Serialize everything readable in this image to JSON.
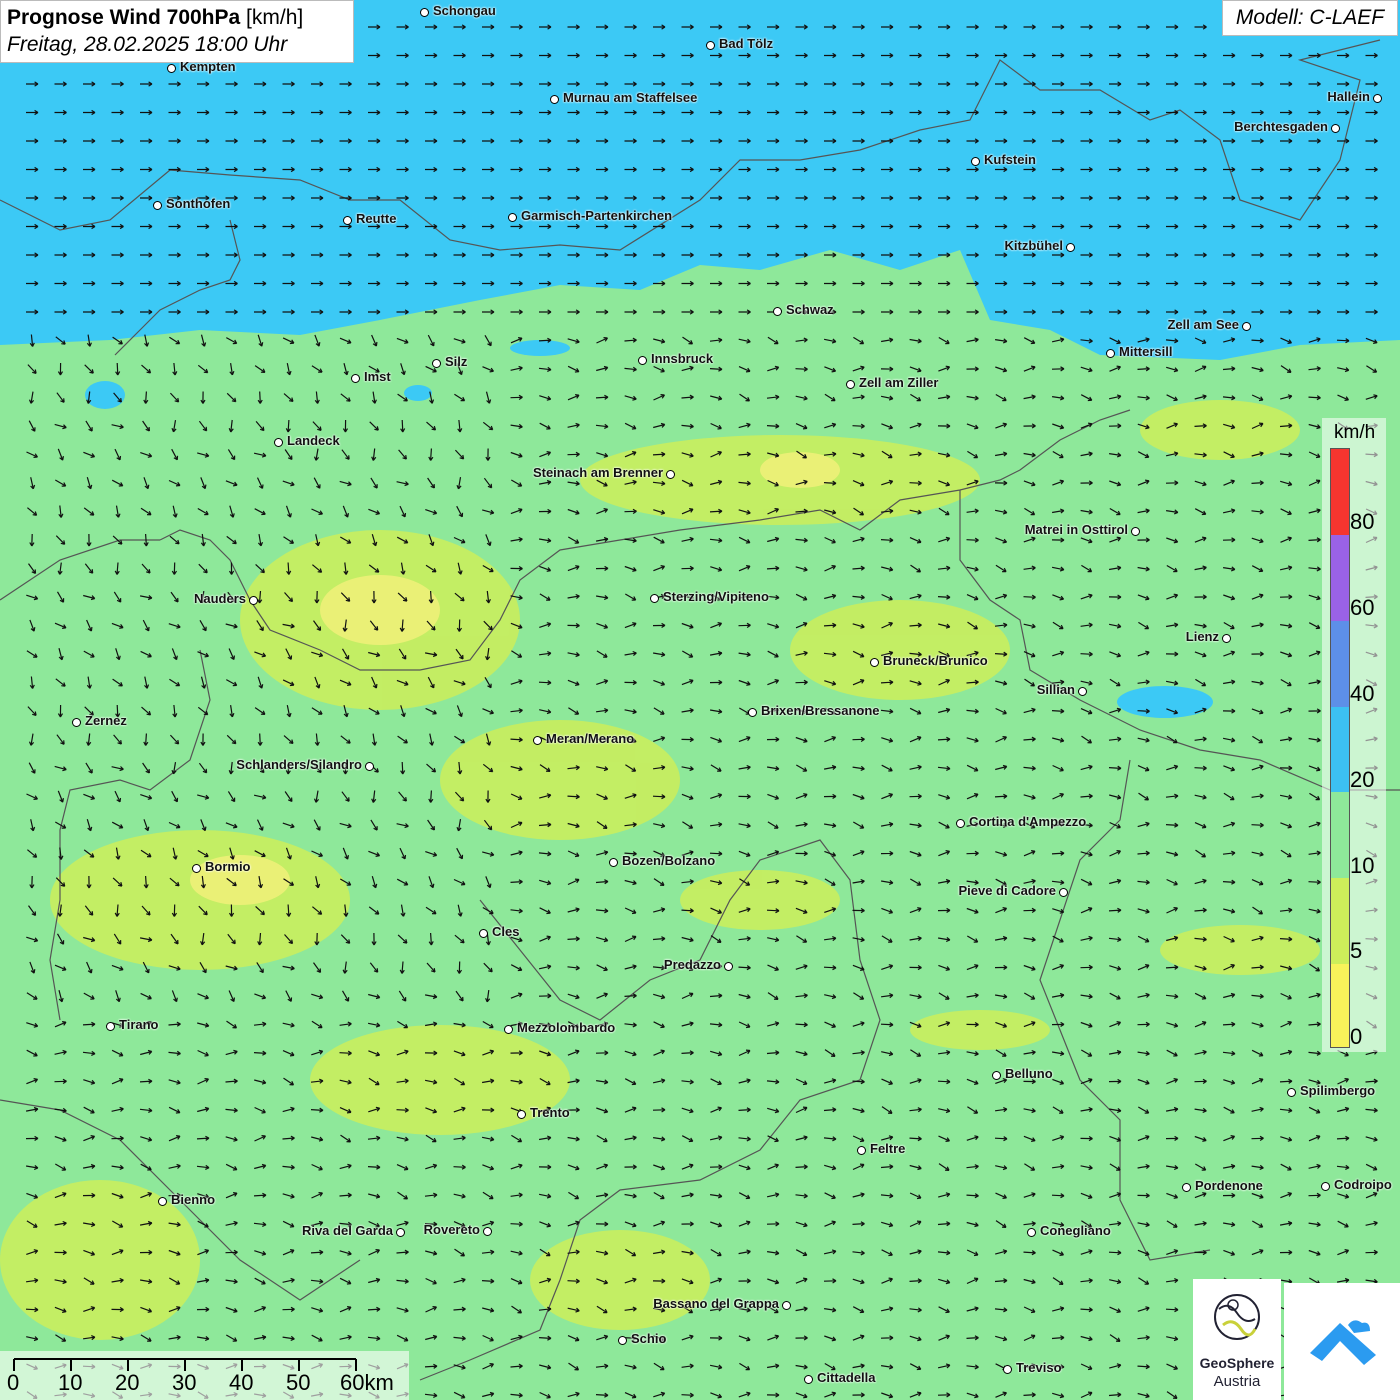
{
  "header": {
    "title_bold": "Prognose Wind 700hPa",
    "title_unit": "[km/h]",
    "datetime": "Freitag, 28.02.2025 18:00 Uhr"
  },
  "model_label": "Modell: C-LAEF",
  "legend": {
    "unit": "km/h",
    "ticks": [
      "80",
      "60",
      "40",
      "20",
      "10",
      "5",
      "0"
    ],
    "colors": [
      "#f5352f",
      "#9a62e6",
      "#5d8fe8",
      "#3cc0f2",
      "#8ee89a",
      "#cdee5a",
      "#f8f25a"
    ]
  },
  "scalebar": {
    "labels": [
      "0",
      "10",
      "20",
      "30",
      "40",
      "50",
      "60km"
    ]
  },
  "logo": {
    "line1": "GeoSphere",
    "line2": "Austria"
  },
  "colors": {
    "strong_wind": "#3cc9f5",
    "moderate_wind": "#8ee89a",
    "weak_wind": "#cdee5a",
    "border": "#555555"
  },
  "cities": [
    {
      "name": "Schongau",
      "side": "right"
    },
    {
      "name": "Bad Tölz",
      "side": "right"
    },
    {
      "name": "Kempten",
      "side": "right"
    },
    {
      "name": "Murnau am Staffelsee",
      "side": "right"
    },
    {
      "name": "Hallein",
      "side": "left"
    },
    {
      "name": "Berchtesgaden",
      "side": "left"
    },
    {
      "name": "Kufstein",
      "side": "right"
    },
    {
      "name": "Sonthofen",
      "side": "right"
    },
    {
      "name": "Reutte",
      "side": "right"
    },
    {
      "name": "Garmisch-Partenkirchen",
      "side": "right"
    },
    {
      "name": "Kitzbühel",
      "side": "left"
    },
    {
      "name": "Schwaz",
      "side": "right"
    },
    {
      "name": "Zell am See",
      "side": "left"
    },
    {
      "name": "Mittersill",
      "side": "right"
    },
    {
      "name": "Innsbruck",
      "side": "right"
    },
    {
      "name": "Silz",
      "side": "right"
    },
    {
      "name": "Imst",
      "side": "right"
    },
    {
      "name": "Zell am Ziller",
      "side": "right"
    },
    {
      "name": "Landeck",
      "side": "right"
    },
    {
      "name": "Steinach am Brenner",
      "side": "left"
    },
    {
      "name": "Matrei in Osttirol",
      "side": "left"
    },
    {
      "name": "Nauders",
      "side": "left"
    },
    {
      "name": "Sterzing/Vipiteno",
      "side": "right"
    },
    {
      "name": "Lienz",
      "side": "left"
    },
    {
      "name": "Bruneck/Brunico",
      "side": "right"
    },
    {
      "name": "Sillian",
      "side": "left"
    },
    {
      "name": "Brixen/Bressanone",
      "side": "right"
    },
    {
      "name": "Zernez",
      "side": "right"
    },
    {
      "name": "Meran/Merano",
      "side": "right"
    },
    {
      "name": "Schlanders/Silandro",
      "side": "left"
    },
    {
      "name": "Cortina d'Ampezzo",
      "side": "right"
    },
    {
      "name": "Bozen/Bolzano",
      "side": "right"
    },
    {
      "name": "Bormio",
      "side": "right"
    },
    {
      "name": "Pieve di Cadore",
      "side": "left"
    },
    {
      "name": "Cles",
      "side": "right"
    },
    {
      "name": "Predazzo",
      "side": "left"
    },
    {
      "name": "Tirano",
      "side": "right"
    },
    {
      "name": "Mezzolombardo",
      "side": "right"
    },
    {
      "name": "Belluno",
      "side": "right"
    },
    {
      "name": "Spilimbergo",
      "side": "right"
    },
    {
      "name": "Trento",
      "side": "right"
    },
    {
      "name": "Feltre",
      "side": "right"
    },
    {
      "name": "Pordenone",
      "side": "right"
    },
    {
      "name": "Codroipo",
      "side": "right"
    },
    {
      "name": "Bienno",
      "side": "right"
    },
    {
      "name": "Riva del Garda",
      "side": "left"
    },
    {
      "name": "Rovereto",
      "side": "left"
    },
    {
      "name": "Conegliano",
      "side": "right"
    },
    {
      "name": "Bassano del Grappa",
      "side": "left"
    },
    {
      "name": "Schio",
      "side": "right"
    },
    {
      "name": "Treviso",
      "side": "right"
    },
    {
      "name": "Cittadella",
      "side": "right"
    }
  ]
}
